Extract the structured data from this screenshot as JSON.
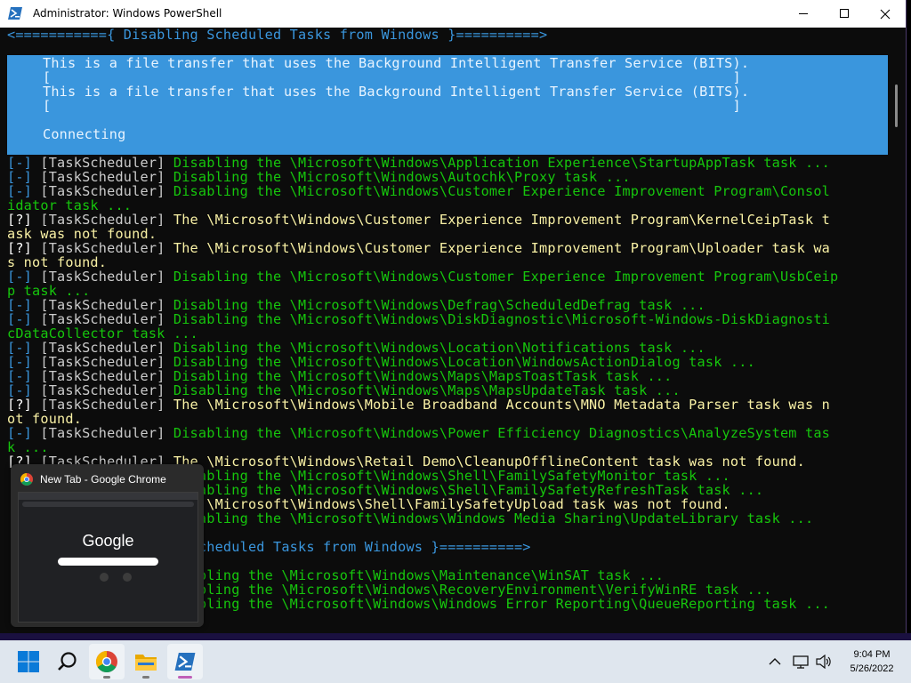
{
  "window": {
    "title": "Administrator: Windows PowerShell"
  },
  "console": {
    "header": "<==========={ Disabling Scheduled Tasks from Windows }==========>",
    "progress": [
      "This is a file transfer that uses the Background Intelligent Transfer Service (BITS).",
      "[                                                                                  ]",
      "This is a file transfer that uses the Background Intelligent Transfer Service (BITS).",
      "[                                                                                  ]",
      "",
      "Connecting"
    ],
    "lines": [
      {
        "s": "[-]",
        "t": "[TaskScheduler]",
        "m": "Disabling the \\Microsoft\\Windows\\Application Experience\\StartupAppTask task ...",
        "c": "g"
      },
      {
        "s": "[-]",
        "t": "[TaskScheduler]",
        "m": "Disabling the \\Microsoft\\Windows\\Autochk\\Proxy task ...",
        "c": "g"
      },
      {
        "s": "[-]",
        "t": "[TaskScheduler]",
        "m": "Disabling the \\Microsoft\\Windows\\Customer Experience Improvement Program\\Consol",
        "c": "g"
      },
      {
        "s": "",
        "t": "",
        "m": "idator task ...",
        "c": "g"
      },
      {
        "s": "[?]",
        "t": "[TaskScheduler]",
        "m": "The \\Microsoft\\Windows\\Customer Experience Improvement Program\\KernelCeipTask t",
        "c": "y"
      },
      {
        "s": "",
        "t": "",
        "m": "ask was not found.",
        "c": "y"
      },
      {
        "s": "[?]",
        "t": "[TaskScheduler]",
        "m": "The \\Microsoft\\Windows\\Customer Experience Improvement Program\\Uploader task wa",
        "c": "y"
      },
      {
        "s": "",
        "t": "",
        "m": "s not found.",
        "c": "y"
      },
      {
        "s": "[-]",
        "t": "[TaskScheduler]",
        "m": "Disabling the \\Microsoft\\Windows\\Customer Experience Improvement Program\\UsbCeip",
        "c": "g"
      },
      {
        "s": "",
        "t": "",
        "m": "p task ...",
        "c": "g"
      },
      {
        "s": "[-]",
        "t": "[TaskScheduler]",
        "m": "Disabling the \\Microsoft\\Windows\\Defrag\\ScheduledDefrag task ...",
        "c": "g"
      },
      {
        "s": "[-]",
        "t": "[TaskScheduler]",
        "m": "Disabling the \\Microsoft\\Windows\\DiskDiagnostic\\Microsoft-Windows-DiskDiagnosti",
        "c": "g"
      },
      {
        "s": "",
        "t": "",
        "m": "cDataCollector task ...",
        "c": "g"
      },
      {
        "s": "[-]",
        "t": "[TaskScheduler]",
        "m": "Disabling the \\Microsoft\\Windows\\Location\\Notifications task ...",
        "c": "g"
      },
      {
        "s": "[-]",
        "t": "[TaskScheduler]",
        "m": "Disabling the \\Microsoft\\Windows\\Location\\WindowsActionDialog task ...",
        "c": "g"
      },
      {
        "s": "[-]",
        "t": "[TaskScheduler]",
        "m": "Disabling the \\Microsoft\\Windows\\Maps\\MapsToastTask task ...",
        "c": "g"
      },
      {
        "s": "[-]",
        "t": "[TaskScheduler]",
        "m": "Disabling the \\Microsoft\\Windows\\Maps\\MapsUpdateTask task ...",
        "c": "g"
      },
      {
        "s": "[?]",
        "t": "[TaskScheduler]",
        "m": "The \\Microsoft\\Windows\\Mobile Broadband Accounts\\MNO Metadata Parser task was n",
        "c": "y"
      },
      {
        "s": "",
        "t": "",
        "m": "ot found.",
        "c": "y"
      },
      {
        "s": "[-]",
        "t": "[TaskScheduler]",
        "m": "Disabling the \\Microsoft\\Windows\\Power Efficiency Diagnostics\\AnalyzeSystem tas",
        "c": "g"
      },
      {
        "s": "",
        "t": "",
        "m": "k ...",
        "c": "g"
      },
      {
        "s": "[?]",
        "t": "[TaskScheduler]",
        "m": "The \\Microsoft\\Windows\\Retail Demo\\CleanupOfflineContent task was not found.",
        "c": "y"
      },
      {
        "s": "",
        "t": "",
        "m": "                      sabling the \\Microsoft\\Windows\\Shell\\FamilySafetyMonitor task ...",
        "c": "g"
      },
      {
        "s": "",
        "t": "",
        "m": "                      sabling the \\Microsoft\\Windows\\Shell\\FamilySafetyRefreshTask task ...",
        "c": "g"
      },
      {
        "s": "",
        "t": "",
        "m": "                      e \\Microsoft\\Windows\\Shell\\FamilySafetyUpload task was not found.",
        "c": "y"
      },
      {
        "s": "",
        "t": "",
        "m": "                      sabling the \\Microsoft\\Windows\\Windows Media Sharing\\UpdateLibrary task ...",
        "c": "g"
      },
      {
        "s": "",
        "t": "",
        "m": "",
        "c": "g"
      },
      {
        "s": "",
        "t": "",
        "m": "                      Scheduled Tasks from Windows }==========>",
        "c": "c"
      },
      {
        "s": "",
        "t": "",
        "m": "",
        "c": "g"
      },
      {
        "s": "",
        "t": "",
        "m": "                      abling the \\Microsoft\\Windows\\Maintenance\\WinSAT task ...",
        "c": "g"
      },
      {
        "s": "",
        "t": "",
        "m": "                      abling the \\Microsoft\\Windows\\RecoveryEnvironment\\VerifyWinRE task ...",
        "c": "g"
      },
      {
        "s": "",
        "t": "",
        "m": "                      abling the \\Microsoft\\Windows\\Windows Error Reporting\\QueueReporting task ...",
        "c": "g"
      }
    ]
  },
  "preview": {
    "title": "New Tab - Google Chrome",
    "logo": "Google"
  },
  "taskbar": {
    "apps": [
      "start-icon",
      "search-icon",
      "chrome-icon",
      "file-explorer-icon",
      "powershell-icon"
    ],
    "time": "9:04 PM",
    "date": "5/26/2022"
  },
  "colors": {
    "progress_band": "#3a96dd",
    "success": "#16c60c",
    "warning": "#f9f1a5",
    "header": "#3a96dd"
  }
}
